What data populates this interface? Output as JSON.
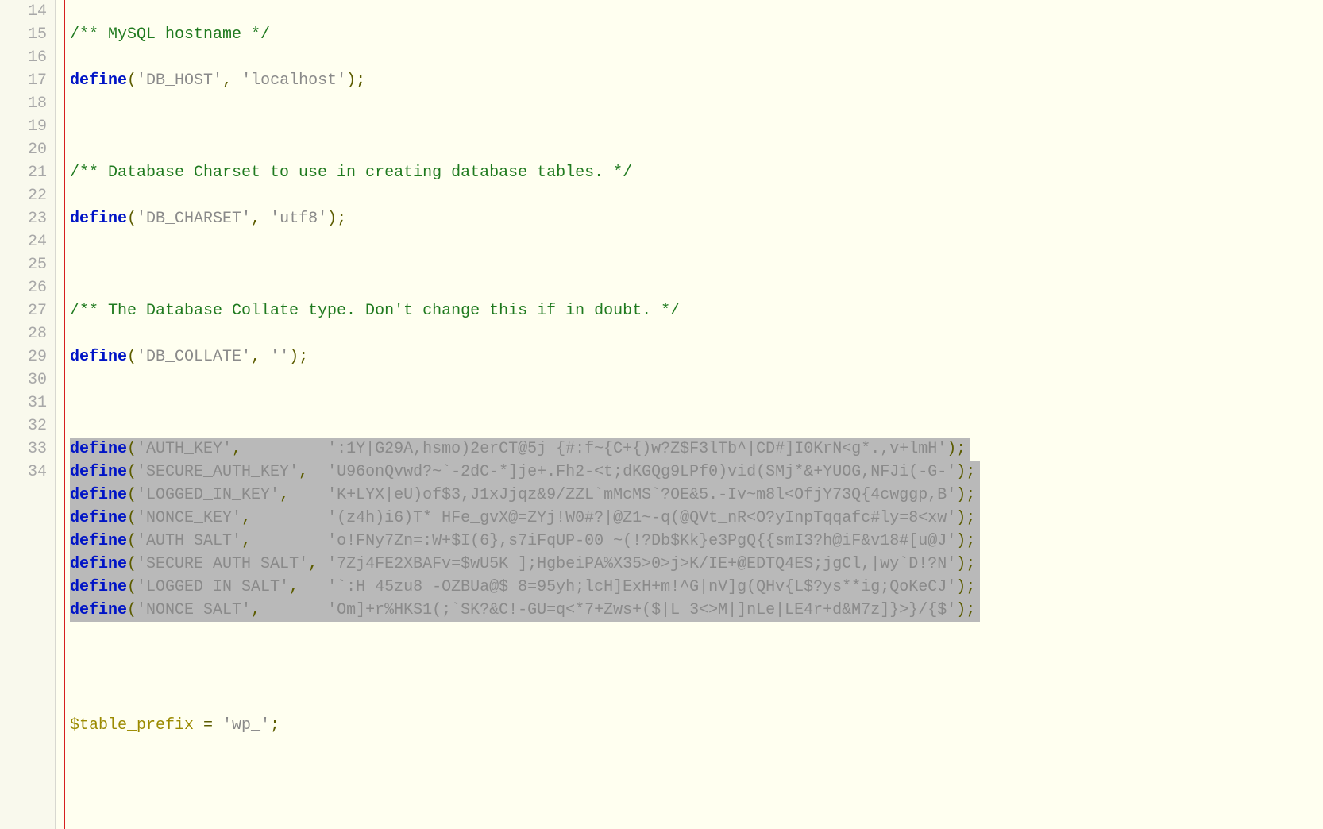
{
  "line_numbers": [
    "14",
    "15",
    "16",
    "17",
    "18",
    "19",
    "20",
    "21",
    "22",
    "23",
    "24",
    "25",
    "26",
    "27",
    "28",
    "29",
    "30",
    "31",
    "32",
    "33",
    "34"
  ],
  "c14": "/** MySQL hostname */",
  "kw": "define",
  "l15_key": "'DB_HOST'",
  "l15_val": "'localhost'",
  "c17": "/** Database Charset to use in creating database tables. */",
  "l18_key": "'DB_CHARSET'",
  "l18_val": "'utf8'",
  "c20": "/** The Database Collate type. Don't change this if in doubt. */",
  "l21_key": "'DB_COLLATE'",
  "l21_val": "''",
  "keys": {
    "l23_key": "'AUTH_KEY'",
    "l23_val": "':1Y|G29A,hsmo)2erCT@5j {#:f~{C+{)w?Z$F3lTb^|CD#]I0KrN<g*.,v+lmH'",
    "l24_key": "'SECURE_AUTH_KEY'",
    "l24_val": "'U96onQvwd?~`-2dC-*]je+.Fh2-<t;dKGQg9LPf0)vid(SMj*&+YUOG,NFJi(-G-'",
    "l25_key": "'LOGGED_IN_KEY'",
    "l25_val": "'K+LYX|eU)of$3,J1xJjqz&9/ZZL`mMcMS`?OE&5.-Iv~m8l<OfjY73Q{4cwggp,B'",
    "l26_key": "'NONCE_KEY'",
    "l26_val": "'(z4h)i6)T* HFe_gvX@=ZYj!W0#?|@Z1~-q(@QVt_nR<O?yInpTqqafc#ly=8<xw'",
    "l27_key": "'AUTH_SALT'",
    "l27_val": "'o!FNy7Zn=:W+$I(6},s7iFqUP-00 ~(!?Db$Kk}e3PgQ{{smI3?h@iF&v18#[u@J'",
    "l28_key": "'SECURE_AUTH_SALT'",
    "l28_val": "'7Zj4FE2XBAFv=$wU5K ];HgbeiPA%X35>0>j>K/IE+@EDTQ4ES;jgCl,|wy`D!?N'",
    "l29_key": "'LOGGED_IN_SALT'",
    "l29_val": "'`:H_45zu8 -OZBUa@$ 8=95yh;lcH]ExH+m!^G|nV]g(QHv{L$?ys**ig;QoKeCJ'",
    "l30_key": "'NONCE_SALT'",
    "l30_val": "'Om]+r%HKS1(;`SK?&C!-GU=q<*7+Zws+($|L_3<>M|]nLe|LE4r+d&M7z]}>}/{$'"
  },
  "pad": {
    "l23": ",         ",
    "l24": ",  ",
    "l25": ",    ",
    "l26": ",        ",
    "l27": ",        ",
    "l28": ", ",
    "l29": ",   ",
    "l30": ",       "
  },
  "l33_var": "$table_prefix",
  "l33_val": "'wp_'",
  "paren_open": "(",
  "paren_close_semi": ");",
  "comma_sp": ", ",
  "eq": " = ",
  "semi": ";"
}
